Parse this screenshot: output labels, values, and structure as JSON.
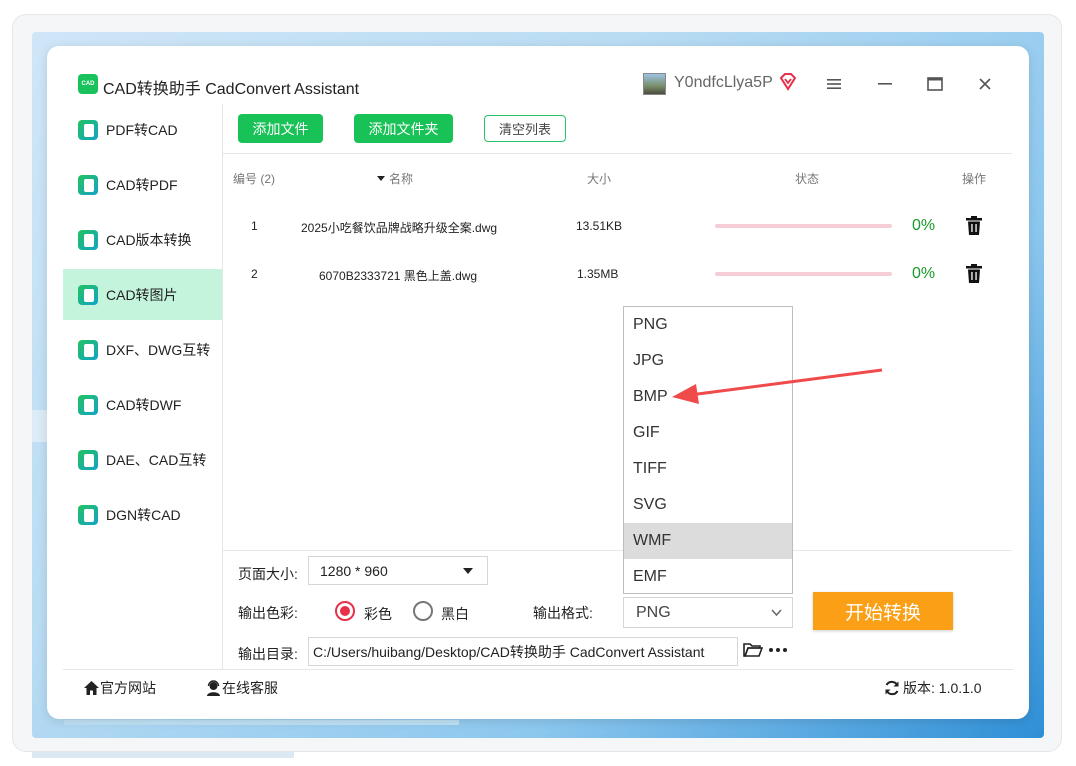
{
  "app": {
    "logo_text": "CAD",
    "title": "CAD转换助手 CadConvert Assistant",
    "username": "Y0ndfcLlya5P"
  },
  "sidebar": {
    "items": [
      {
        "label": "PDF转CAD",
        "active": false
      },
      {
        "label": "CAD转PDF",
        "active": false
      },
      {
        "label": "CAD版本转换",
        "active": false
      },
      {
        "label": "CAD转图片",
        "active": true
      },
      {
        "label": "DXF、DWG互转",
        "active": false
      },
      {
        "label": "CAD转DWF",
        "active": false
      },
      {
        "label": "DAE、CAD互转",
        "active": false
      },
      {
        "label": "DGN转CAD",
        "active": false
      }
    ]
  },
  "toolbar": {
    "add_file": "添加文件",
    "add_folder": "添加文件夹",
    "clear_list": "清空列表"
  },
  "table": {
    "headers": {
      "index": "编号 (2)",
      "name": "名称",
      "size": "大小",
      "status": "状态",
      "action": "操作"
    },
    "rows": [
      {
        "index": "1",
        "name": "2025小吃餐饮品牌战略升级全案.dwg",
        "size": "13.51KB",
        "progress": 0,
        "percent": "0%"
      },
      {
        "index": "2",
        "name": "6070B2333721 黑色上盖.dwg",
        "size": "1.35MB",
        "progress": 0,
        "percent": "0%"
      }
    ]
  },
  "format_dropdown": {
    "options": [
      "PNG",
      "JPG",
      "BMP",
      "GIF",
      "TIFF",
      "SVG",
      "WMF",
      "EMF"
    ],
    "highlighted": "WMF",
    "annotation_arrow_target": "BMP"
  },
  "settings": {
    "page_size_label": "页面大小:",
    "page_size_value": "1280 * 960",
    "color_label": "输出色彩:",
    "color_option": "彩色",
    "bw_option": "黑白",
    "color_selected": "彩色",
    "format_label": "输出格式:",
    "format_value": "PNG",
    "start_button": "开始转换",
    "output_dir_label": "输出目录:",
    "output_dir_value": "C:/Users/huibang/Desktop/CAD转换助手 CadConvert Assistant"
  },
  "footer": {
    "website": "官方网站",
    "support": "在线客服",
    "version": "版本: 1.0.1.0"
  },
  "colors": {
    "green": "#18c257",
    "active_bg": "#c4f5dc",
    "orange": "#fa9f16",
    "red_accent": "#e8304a",
    "percent_green": "#1a9a2a"
  }
}
